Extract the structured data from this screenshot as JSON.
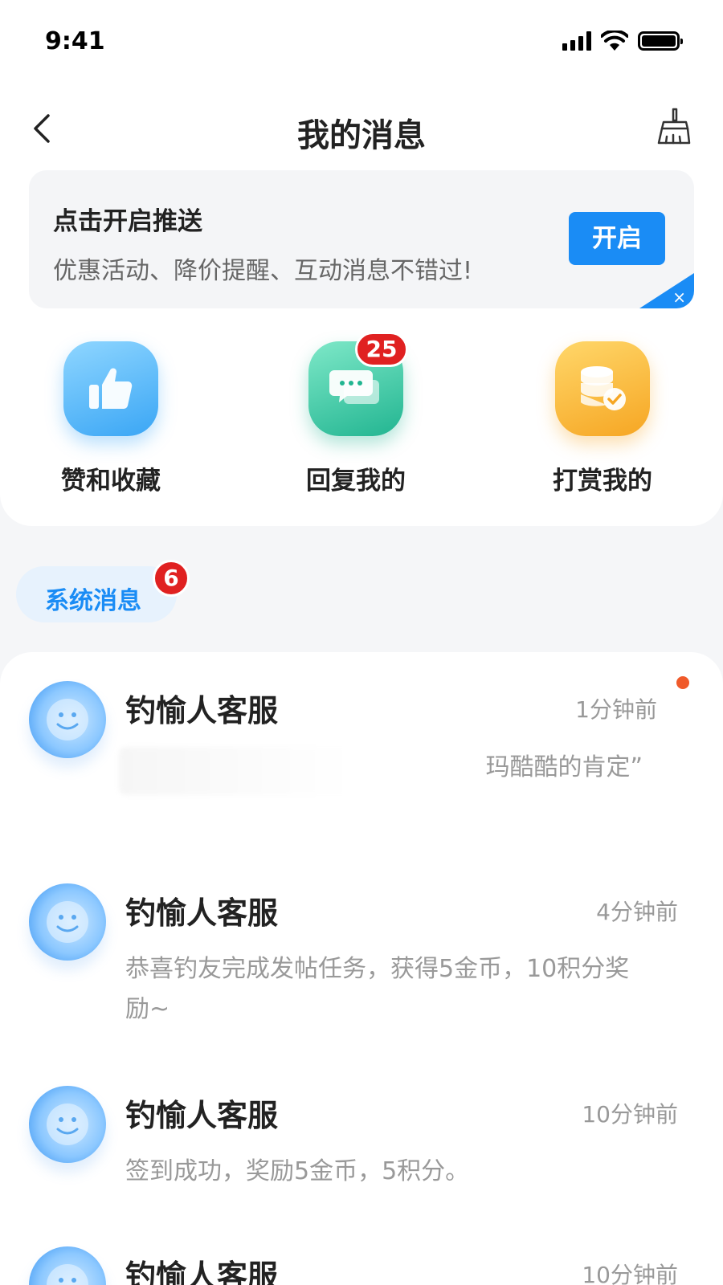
{
  "status_bar": {
    "time": "9:41"
  },
  "nav": {
    "title": "我的消息"
  },
  "push_banner": {
    "title": "点击开启推送",
    "description": "优惠活动、降价提醒、互动消息不错过!",
    "button_label": "开启",
    "close_symbol": "×"
  },
  "quick_actions": [
    {
      "label": "赞和收藏",
      "icon": "thumbs-up-icon"
    },
    {
      "label": "回复我的",
      "icon": "chat-bubbles-icon",
      "badge": "25"
    },
    {
      "label": "打赏我的",
      "icon": "coins-icon"
    }
  ],
  "system_tab": {
    "label": "系统消息",
    "badge": "6"
  },
  "messages": [
    {
      "name": "钓愉人客服",
      "time": "1分钟前",
      "text": "玛酷酷的肯定”",
      "unread": true
    },
    {
      "name": "钓愉人客服",
      "time": "4分钟前",
      "text": "恭喜钓友完成发帖任务，获得5金币，10积分奖励~"
    },
    {
      "name": "钓愉人客服",
      "time": "10分钟前",
      "text": "签到成功，奖励5金币，5积分。"
    },
    {
      "name": "钓愉人客服",
      "time": "10分钟前",
      "text": ""
    }
  ],
  "colors": {
    "accent": "#1a8cf5",
    "badge_red": "#e02121",
    "unread_dot": "#f05a2a",
    "like_icon_bg": "#3aa6f5",
    "reply_icon_bg": "#22b591",
    "reward_icon_bg": "#f6a623"
  }
}
